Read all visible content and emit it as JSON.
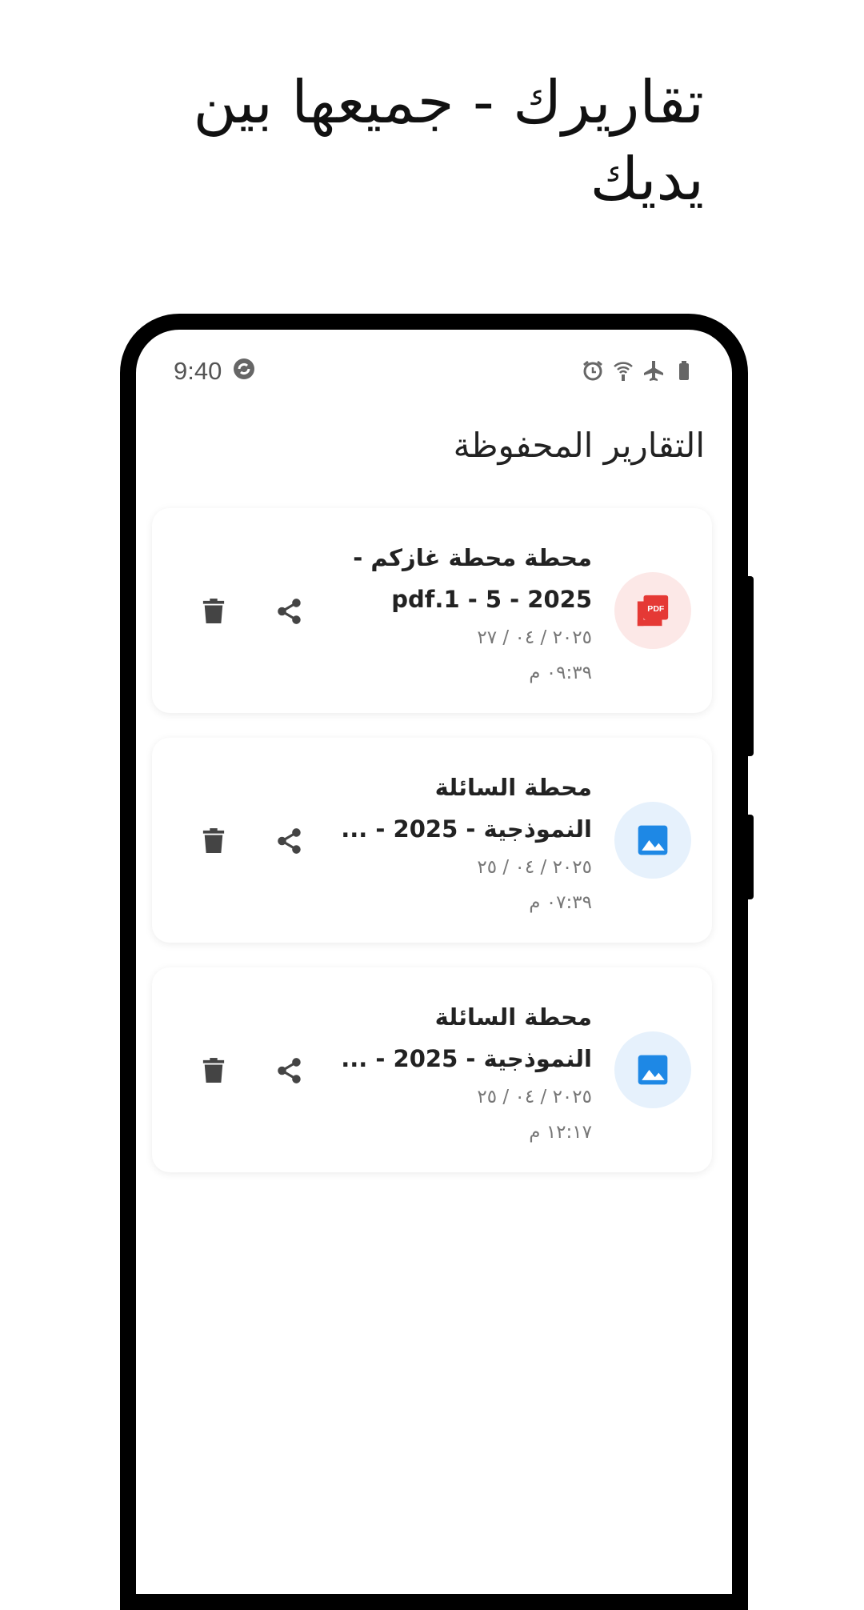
{
  "promo": {
    "headline": "تقاريرك - جميعها بين يديك"
  },
  "status_bar": {
    "time": "9:40",
    "left_icon": "sync-circle-icon",
    "right_icons": [
      "alarm-icon",
      "wifi-calling-icon",
      "airplane-icon",
      "battery-icon"
    ]
  },
  "screen": {
    "title": "التقارير المحفوظة"
  },
  "reports": [
    {
      "type": "pdf",
      "icon": "pdf-file-icon",
      "name_line1": "محطة محطة غازكم -",
      "name_line2": "2025 - 5 - 1.pdf",
      "date": "٢٠٢٥ / ٠٤ / ٢٧",
      "time": "٠٩:٣٩ م"
    },
    {
      "type": "image",
      "icon": "image-file-icon",
      "name_line1": "محطة السائلة",
      "name_line2": "النموذجية - 2025 - ...",
      "date": "٢٠٢٥ / ٠٤ / ٢٥",
      "time": "٠٧:٣٩ م"
    },
    {
      "type": "image",
      "icon": "image-file-icon",
      "name_line1": "محطة السائلة",
      "name_line2": "النموذجية - 2025 - ...",
      "date": "٢٠٢٥ / ٠٤ / ٢٥",
      "time": "١٢:١٧ م"
    }
  ],
  "colors": {
    "pdf_accent": "#e53935",
    "image_accent": "#1e88e5",
    "action_icon": "#444444"
  }
}
